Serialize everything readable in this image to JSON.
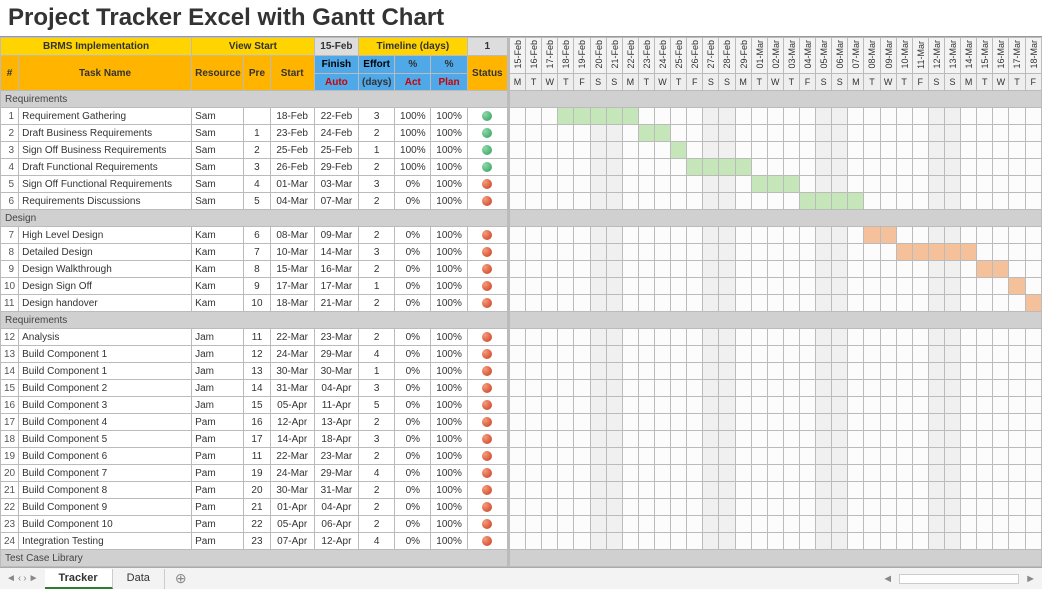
{
  "title": "Project Tracker Excel with Gantt Chart",
  "header": {
    "project": "BRMS Implementation",
    "view_start_label": "View Start",
    "view_start_value": "15-Feb",
    "timeline_label": "Timeline (days)",
    "timeline_value": "1",
    "cols": {
      "num": "#",
      "task": "Task Name",
      "resource": "Resource",
      "pre": "Pre",
      "start": "Start",
      "finish": "Finish",
      "effort": "Effort",
      "pct_act": "%",
      "pct_plan": "%",
      "status": "Status"
    },
    "sub": {
      "auto": "Auto",
      "days": "(days)",
      "act": "Act",
      "plan": "Plan"
    }
  },
  "gantt": {
    "dates": [
      "15-Feb",
      "16-Feb",
      "17-Feb",
      "18-Feb",
      "19-Feb",
      "20-Feb",
      "21-Feb",
      "22-Feb",
      "23-Feb",
      "24-Feb",
      "25-Feb",
      "26-Feb",
      "27-Feb",
      "28-Feb",
      "29-Feb",
      "01-Mar",
      "02-Mar",
      "03-Mar",
      "04-Mar",
      "05-Mar",
      "06-Mar",
      "07-Mar",
      "08-Mar",
      "09-Mar",
      "10-Mar",
      "11-Mar",
      "12-Mar",
      "13-Mar",
      "14-Mar",
      "15-Mar",
      "16-Mar",
      "17-Mar",
      "18-Mar"
    ],
    "dow": [
      "M",
      "T",
      "W",
      "T",
      "F",
      "S",
      "S",
      "M",
      "T",
      "W",
      "T",
      "F",
      "S",
      "S",
      "M",
      "T",
      "W",
      "T",
      "F",
      "S",
      "S",
      "M",
      "T",
      "W",
      "T",
      "F",
      "S",
      "S",
      "M",
      "T",
      "W",
      "T",
      "F"
    ]
  },
  "sections": [
    {
      "name": "Requirements",
      "tasks": [
        {
          "n": 1,
          "name": "Requirement Gathering",
          "res": "Sam",
          "pre": "",
          "start": "18-Feb",
          "finish": "22-Feb",
          "eff": 3,
          "act": "100%",
          "plan": "100%",
          "status": "green",
          "bar": [
            3,
            7,
            "done"
          ]
        },
        {
          "n": 2,
          "name": "Draft Business Requirements",
          "res": "Sam",
          "pre": 1,
          "start": "23-Feb",
          "finish": "24-Feb",
          "eff": 2,
          "act": "100%",
          "plan": "100%",
          "status": "green",
          "bar": [
            8,
            9,
            "done"
          ]
        },
        {
          "n": 3,
          "name": "Sign Off Business Requirements",
          "res": "Sam",
          "pre": 2,
          "start": "25-Feb",
          "finish": "25-Feb",
          "eff": 1,
          "act": "100%",
          "plan": "100%",
          "status": "green",
          "bar": [
            10,
            10,
            "done"
          ]
        },
        {
          "n": 4,
          "name": "Draft Functional Requirements",
          "res": "Sam",
          "pre": 3,
          "start": "26-Feb",
          "finish": "29-Feb",
          "eff": 2,
          "act": "100%",
          "plan": "100%",
          "status": "green",
          "bar": [
            11,
            14,
            "done"
          ]
        },
        {
          "n": 5,
          "name": "Sign Off Functional Requirements",
          "res": "Sam",
          "pre": 4,
          "start": "01-Mar",
          "finish": "03-Mar",
          "eff": 3,
          "act": "0%",
          "plan": "100%",
          "status": "red",
          "bar": [
            15,
            17,
            "done"
          ]
        },
        {
          "n": 6,
          "name": "Requirements Discussions",
          "res": "Sam",
          "pre": 5,
          "start": "04-Mar",
          "finish": "07-Mar",
          "eff": 2,
          "act": "0%",
          "plan": "100%",
          "status": "red",
          "bar": [
            18,
            21,
            "done"
          ]
        }
      ]
    },
    {
      "name": "Design",
      "tasks": [
        {
          "n": 7,
          "name": "High Level Design",
          "res": "Kam",
          "pre": 6,
          "start": "08-Mar",
          "finish": "09-Mar",
          "eff": 2,
          "act": "0%",
          "plan": "100%",
          "status": "red",
          "bar": [
            22,
            23,
            "plan"
          ]
        },
        {
          "n": 8,
          "name": "Detailed Design",
          "res": "Kam",
          "pre": 7,
          "start": "10-Mar",
          "finish": "14-Mar",
          "eff": 3,
          "act": "0%",
          "plan": "100%",
          "status": "red",
          "bar": [
            24,
            28,
            "plan"
          ]
        },
        {
          "n": 9,
          "name": "Design Walkthrough",
          "res": "Kam",
          "pre": 8,
          "start": "15-Mar",
          "finish": "16-Mar",
          "eff": 2,
          "act": "0%",
          "plan": "100%",
          "status": "red",
          "bar": [
            29,
            30,
            "plan"
          ]
        },
        {
          "n": 10,
          "name": "Design Sign Off",
          "res": "Kam",
          "pre": 9,
          "start": "17-Mar",
          "finish": "17-Mar",
          "eff": 1,
          "act": "0%",
          "plan": "100%",
          "status": "red",
          "bar": [
            31,
            31,
            "plan"
          ]
        },
        {
          "n": 11,
          "name": "Design handover",
          "res": "Kam",
          "pre": 10,
          "start": "18-Mar",
          "finish": "21-Mar",
          "eff": 2,
          "act": "0%",
          "plan": "100%",
          "status": "red",
          "bar": [
            32,
            32,
            "plan"
          ]
        }
      ]
    },
    {
      "name": "Requirements",
      "tasks": [
        {
          "n": 12,
          "name": "Analysis",
          "res": "Jam",
          "pre": 11,
          "start": "22-Mar",
          "finish": "23-Mar",
          "eff": 2,
          "act": "0%",
          "plan": "100%",
          "status": "red"
        },
        {
          "n": 13,
          "name": "Build Component 1",
          "res": "Jam",
          "pre": 12,
          "start": "24-Mar",
          "finish": "29-Mar",
          "eff": 4,
          "act": "0%",
          "plan": "100%",
          "status": "red"
        },
        {
          "n": 14,
          "name": "Build Component 1",
          "res": "Jam",
          "pre": 13,
          "start": "30-Mar",
          "finish": "30-Mar",
          "eff": 1,
          "act": "0%",
          "plan": "100%",
          "status": "red"
        },
        {
          "n": 15,
          "name": "Build Component 2",
          "res": "Jam",
          "pre": 14,
          "start": "31-Mar",
          "finish": "04-Apr",
          "eff": 3,
          "act": "0%",
          "plan": "100%",
          "status": "red"
        },
        {
          "n": 16,
          "name": "Build Component 3",
          "res": "Jam",
          "pre": 15,
          "start": "05-Apr",
          "finish": "11-Apr",
          "eff": 5,
          "act": "0%",
          "plan": "100%",
          "status": "red"
        },
        {
          "n": 17,
          "name": "Build Component 4",
          "res": "Pam",
          "pre": 16,
          "start": "12-Apr",
          "finish": "13-Apr",
          "eff": 2,
          "act": "0%",
          "plan": "100%",
          "status": "red"
        },
        {
          "n": 18,
          "name": "Build Component 5",
          "res": "Pam",
          "pre": 17,
          "start": "14-Apr",
          "finish": "18-Apr",
          "eff": 3,
          "act": "0%",
          "plan": "100%",
          "status": "red"
        },
        {
          "n": 19,
          "name": "Build Component 6",
          "res": "Pam",
          "pre": 11,
          "start": "22-Mar",
          "finish": "23-Mar",
          "eff": 2,
          "act": "0%",
          "plan": "100%",
          "status": "red"
        },
        {
          "n": 20,
          "name": "Build Component 7",
          "res": "Pam",
          "pre": 19,
          "start": "24-Mar",
          "finish": "29-Mar",
          "eff": 4,
          "act": "0%",
          "plan": "100%",
          "status": "red"
        },
        {
          "n": 21,
          "name": "Build Component 8",
          "res": "Pam",
          "pre": 20,
          "start": "30-Mar",
          "finish": "31-Mar",
          "eff": 2,
          "act": "0%",
          "plan": "100%",
          "status": "red"
        },
        {
          "n": 22,
          "name": "Build Component 9",
          "res": "Pam",
          "pre": 21,
          "start": "01-Apr",
          "finish": "04-Apr",
          "eff": 2,
          "act": "0%",
          "plan": "100%",
          "status": "red"
        },
        {
          "n": 23,
          "name": "Build Component 10",
          "res": "Pam",
          "pre": 22,
          "start": "05-Apr",
          "finish": "06-Apr",
          "eff": 2,
          "act": "0%",
          "plan": "100%",
          "status": "red"
        },
        {
          "n": 24,
          "name": "Integration Testing",
          "res": "Pam",
          "pre": 23,
          "start": "07-Apr",
          "finish": "12-Apr",
          "eff": 4,
          "act": "0%",
          "plan": "100%",
          "status": "red"
        }
      ]
    },
    {
      "name": "Test Case Library",
      "tasks": []
    }
  ],
  "footer": {
    "tabs": [
      "Tracker",
      "Data"
    ],
    "active": 0
  },
  "chart_data": {
    "type": "gantt",
    "title": "Project Tracker Excel with Gantt Chart",
    "x_start": "15-Feb",
    "x_dates": [
      "15-Feb",
      "16-Feb",
      "17-Feb",
      "18-Feb",
      "19-Feb",
      "20-Feb",
      "21-Feb",
      "22-Feb",
      "23-Feb",
      "24-Feb",
      "25-Feb",
      "26-Feb",
      "27-Feb",
      "28-Feb",
      "29-Feb",
      "01-Mar",
      "02-Mar",
      "03-Mar",
      "04-Mar",
      "05-Mar",
      "06-Mar",
      "07-Mar",
      "08-Mar",
      "09-Mar",
      "10-Mar",
      "11-Mar",
      "12-Mar",
      "13-Mar",
      "14-Mar",
      "15-Mar",
      "16-Mar",
      "17-Mar",
      "18-Mar"
    ],
    "tasks": [
      {
        "id": 1,
        "name": "Requirement Gathering",
        "start": "18-Feb",
        "finish": "22-Feb",
        "pct_complete": 100,
        "color": "green"
      },
      {
        "id": 2,
        "name": "Draft Business Requirements",
        "start": "23-Feb",
        "finish": "24-Feb",
        "pct_complete": 100,
        "color": "green"
      },
      {
        "id": 3,
        "name": "Sign Off Business Requirements",
        "start": "25-Feb",
        "finish": "25-Feb",
        "pct_complete": 100,
        "color": "green"
      },
      {
        "id": 4,
        "name": "Draft Functional Requirements",
        "start": "26-Feb",
        "finish": "29-Feb",
        "pct_complete": 100,
        "color": "green"
      },
      {
        "id": 5,
        "name": "Sign Off Functional Requirements",
        "start": "01-Mar",
        "finish": "03-Mar",
        "pct_complete": 0,
        "color": "green"
      },
      {
        "id": 6,
        "name": "Requirements Discussions",
        "start": "04-Mar",
        "finish": "07-Mar",
        "pct_complete": 0,
        "color": "green"
      },
      {
        "id": 7,
        "name": "High Level Design",
        "start": "08-Mar",
        "finish": "09-Mar",
        "pct_complete": 0,
        "color": "orange"
      },
      {
        "id": 8,
        "name": "Detailed Design",
        "start": "10-Mar",
        "finish": "14-Mar",
        "pct_complete": 0,
        "color": "orange"
      },
      {
        "id": 9,
        "name": "Design Walkthrough",
        "start": "15-Mar",
        "finish": "16-Mar",
        "pct_complete": 0,
        "color": "orange"
      },
      {
        "id": 10,
        "name": "Design Sign Off",
        "start": "17-Mar",
        "finish": "17-Mar",
        "pct_complete": 0,
        "color": "orange"
      },
      {
        "id": 11,
        "name": "Design handover",
        "start": "18-Mar",
        "finish": "21-Mar",
        "pct_complete": 0,
        "color": "orange"
      }
    ]
  }
}
